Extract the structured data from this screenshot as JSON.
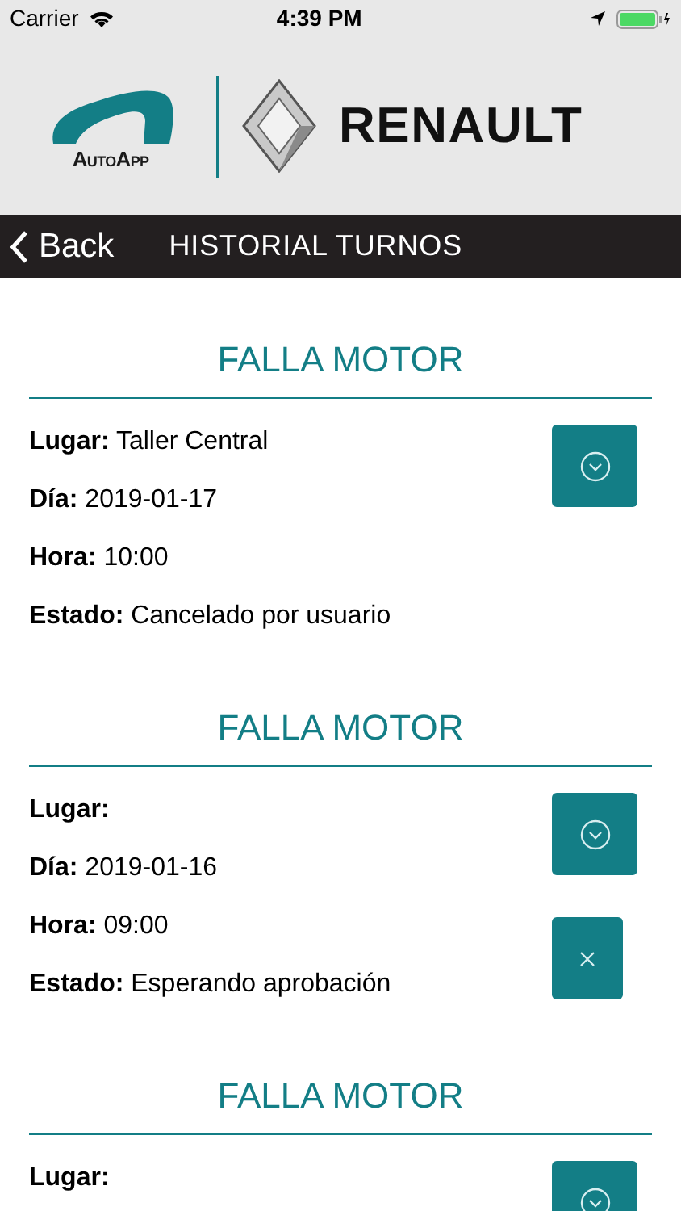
{
  "status_bar": {
    "carrier": "Carrier",
    "time": "4:39 PM"
  },
  "header": {
    "brand_left": "AutoApp",
    "brand_right": "RENAULT"
  },
  "nav": {
    "back": "Back",
    "title": "HISTORIAL TURNOS"
  },
  "appointments": [
    {
      "title": "FALLA MOTOR",
      "fields": [
        {
          "label": "Lugar:",
          "value": "Taller Central"
        },
        {
          "label": "Día:",
          "value": "2019-01-17"
        },
        {
          "label": "Hora:",
          "value": "10:00"
        },
        {
          "label": "Estado:",
          "value": "Cancelado por usuario"
        }
      ],
      "actions": [
        {
          "kind": "expand"
        }
      ]
    },
    {
      "title": "FALLA MOTOR",
      "fields": [
        {
          "label": "Lugar:"
        },
        {
          "label": "Día:",
          "value": "2019-01-16"
        },
        {
          "label": "Hora:",
          "value": "09:00"
        },
        {
          "label": "Estado:",
          "value": "Esperando aprobación"
        }
      ],
      "actions": [
        {
          "kind": "expand"
        },
        {
          "kind": "cancel"
        }
      ]
    },
    {
      "title": "FALLA MOTOR",
      "fields": [
        {
          "label": "Lugar:"
        }
      ],
      "actions": [
        {
          "kind": "expand"
        }
      ]
    }
  ]
}
